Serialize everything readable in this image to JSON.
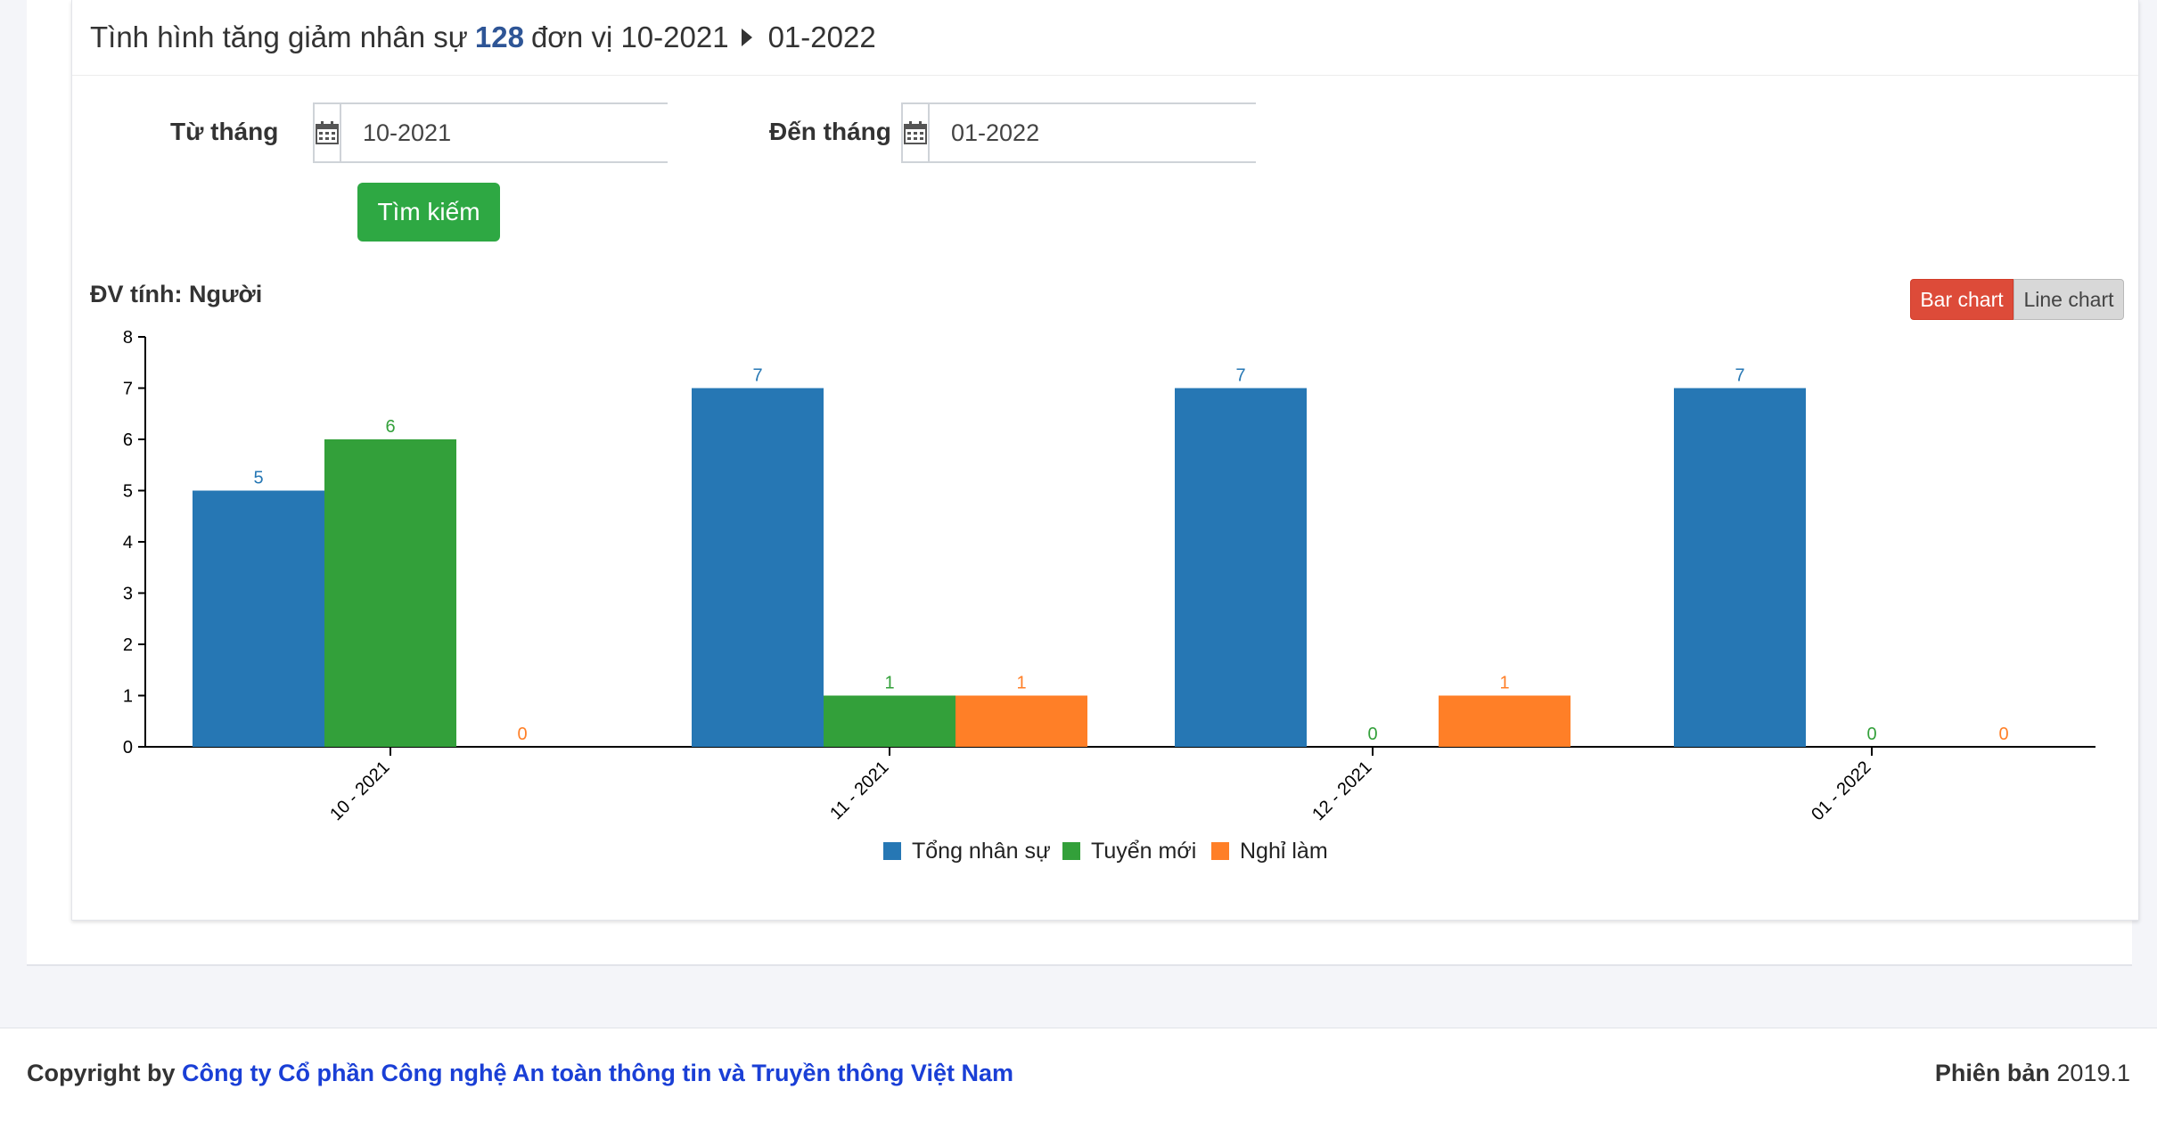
{
  "header": {
    "title_prefix": "Tình hình tăng giảm nhân sự",
    "unit_count": "128",
    "title_mid": "đơn vị 10-2021",
    "title_end": "01-2022"
  },
  "filters": {
    "from_label": "Từ tháng",
    "from_value": "10-2021",
    "to_label": "Đến tháng",
    "to_value": "01-2022",
    "search_label": "Tìm kiếm"
  },
  "unit_label": "ĐV tính: Người",
  "toggle": {
    "bar": "Bar chart",
    "line": "Line chart",
    "active": "bar"
  },
  "chart_data": {
    "type": "bar",
    "categories": [
      "10 - 2021",
      "11 - 2021",
      "12 - 2021",
      "01 - 2022"
    ],
    "series": [
      {
        "name": "Tổng nhân sự",
        "values": [
          5,
          7,
          7,
          7
        ],
        "color": "#2677b4"
      },
      {
        "name": "Tuyển mới",
        "values": [
          6,
          1,
          0,
          0
        ],
        "color": "#33a03a"
      },
      {
        "name": "Nghỉ làm",
        "values": [
          0,
          1,
          1,
          0
        ],
        "color": "#ff7f27"
      }
    ],
    "yticks": [
      0,
      1,
      2,
      3,
      4,
      5,
      6,
      7,
      8
    ],
    "ylim": [
      0,
      8
    ],
    "legend_position": "bottom-center",
    "grid": false
  },
  "footer": {
    "copyright": "Copyright by",
    "company": "Công ty Cổ phần Công nghệ An toàn thông tin và Truyền thông Việt Nam",
    "version_label": "Phiên bản",
    "version": "2019.1"
  }
}
